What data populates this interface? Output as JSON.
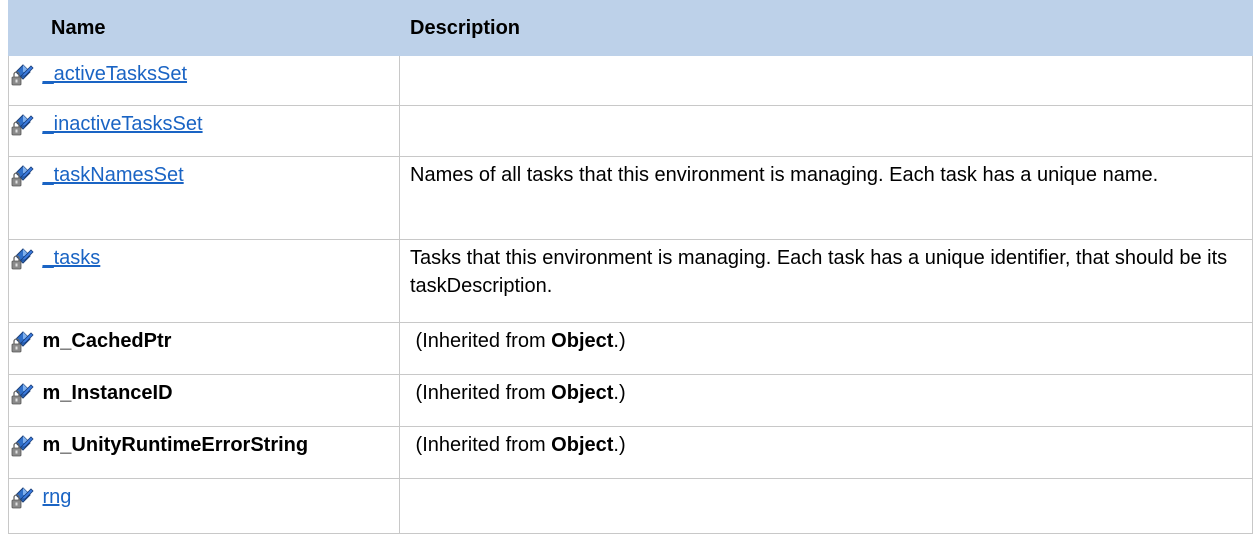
{
  "header": {
    "name": "Name",
    "description": "Description"
  },
  "rows": [
    {
      "name": "_activeTasksSet",
      "link": true,
      "description": ""
    },
    {
      "name": "_inactiveTasksSet",
      "link": true,
      "description": ""
    },
    {
      "name": "_taskNamesSet",
      "link": true,
      "description": "Names of all tasks that this environment is managing. Each task has a unique name."
    },
    {
      "name": "_tasks",
      "link": true,
      "description": "Tasks that this environment is managing. Each task has a unique identifier, that should be its taskDescription."
    },
    {
      "name": "m_CachedPtr",
      "link": false,
      "inherited_prefix": " (Inherited from ",
      "inherited_class": "Object",
      "inherited_suffix": ".)"
    },
    {
      "name": "m_InstanceID",
      "link": false,
      "inherited_prefix": " (Inherited from ",
      "inherited_class": "Object",
      "inherited_suffix": ".)"
    },
    {
      "name": "m_UnityRuntimeErrorString",
      "link": false,
      "inherited_prefix": " (Inherited from ",
      "inherited_class": "Object",
      "inherited_suffix": ".)"
    },
    {
      "name": "rng",
      "link": true,
      "description": ""
    }
  ],
  "icon": "private-field-icon",
  "colors": {
    "header_bg": "#bdd1e9",
    "link": "#1a64c4",
    "border": "#c8c8c8"
  }
}
